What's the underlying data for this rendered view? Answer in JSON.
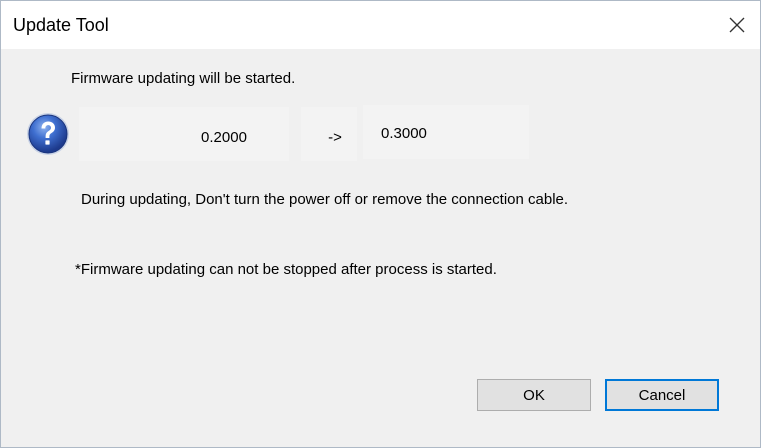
{
  "window": {
    "title": "Update Tool",
    "close_icon": "close-icon"
  },
  "message": {
    "line1": "Firmware updating will be started.",
    "old_version": "0.2000",
    "arrow": "->",
    "new_version": "0.3000",
    "line2": "During updating, Don't turn the power off  or  remove the connection cable.",
    "line3": "*Firmware updating can not be stopped after process is started."
  },
  "icons": {
    "status": "question-icon"
  },
  "buttons": {
    "ok_label": "OK",
    "cancel_label": "Cancel"
  },
  "colors": {
    "dialog_bg": "#f0f0f0",
    "titlebar_bg": "#ffffff",
    "focus_border": "#0078d7",
    "icon_blue": "#2b55b5"
  }
}
